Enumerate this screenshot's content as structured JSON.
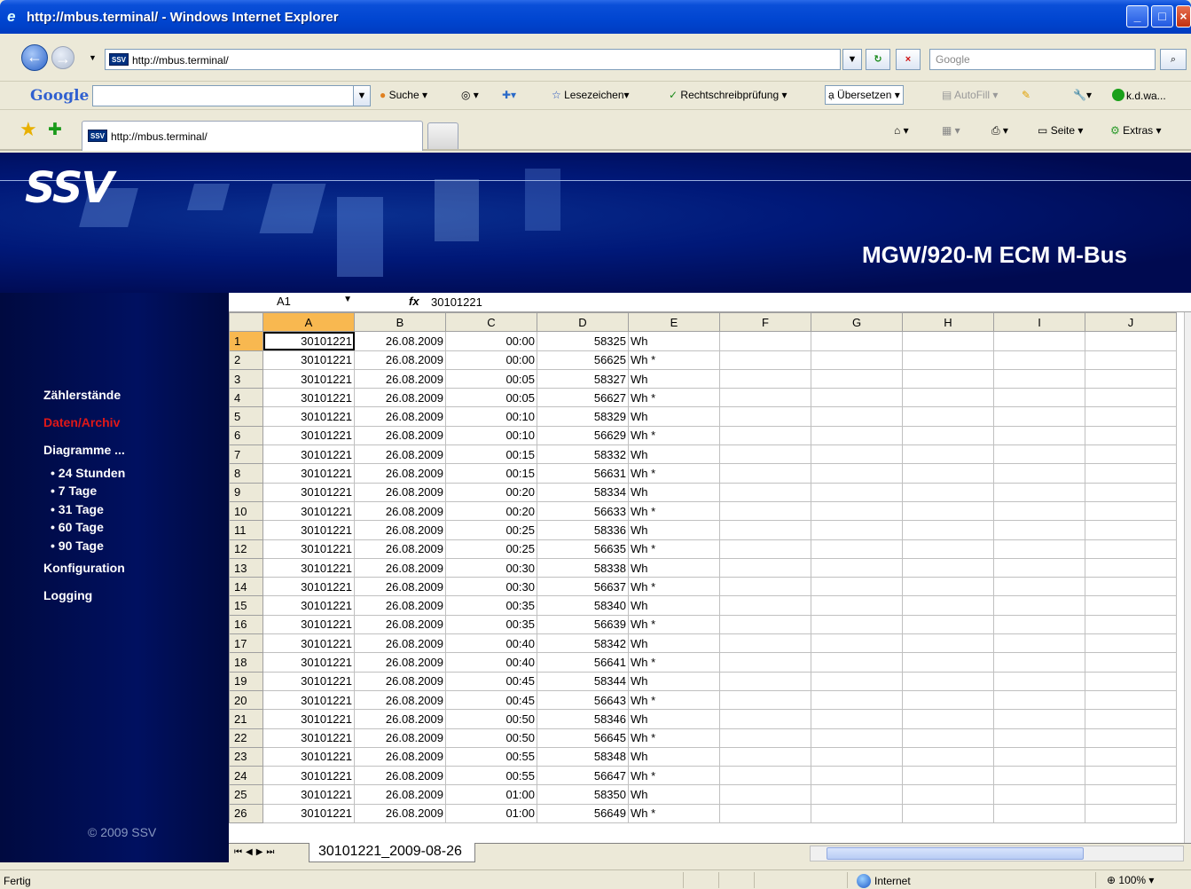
{
  "window": {
    "title": "http://mbus.terminal/ - Windows Internet Explorer"
  },
  "address": {
    "url": "http://mbus.terminal/",
    "search_placeholder": "Google"
  },
  "google_toolbar": {
    "logo": "Google",
    "search_label": "Suche",
    "bookmarks": "Lesezeichen",
    "spellcheck": "Rechtschreibprüfung",
    "translate": "Übersetzen",
    "autofill": "AutoFill",
    "user": "k.d.wa..."
  },
  "tab": {
    "label": "http://mbus.terminal/"
  },
  "commandbar": {
    "page": "Seite",
    "extras": "Extras"
  },
  "banner": {
    "logo": "SSV",
    "product": "MGW/920-M ECM M-Bus"
  },
  "sidebar": {
    "items": [
      {
        "label": "Zählerstände",
        "active": false
      },
      {
        "label": "Daten/Archiv",
        "active": true
      },
      {
        "label": "Diagramme ...",
        "active": false
      },
      {
        "label": "• 24 Stunden",
        "sub": true
      },
      {
        "label": "• 7 Tage",
        "sub": true
      },
      {
        "label": "• 31 Tage",
        "sub": true
      },
      {
        "label": "• 60 Tage",
        "sub": true
      },
      {
        "label": "• 90 Tage",
        "sub": true
      },
      {
        "label": "Konfiguration",
        "active": false
      },
      {
        "label": "Logging",
        "active": false
      }
    ],
    "copyright": "© 2009 SSV"
  },
  "spreadsheet": {
    "name_box": "A1",
    "fx_symbol": "fx",
    "formula_value": "30101221",
    "columns": [
      "A",
      "B",
      "C",
      "D",
      "E",
      "F",
      "G",
      "H",
      "I",
      "J"
    ],
    "rows": [
      [
        "30101221",
        "26.08.2009",
        "00:00",
        "58325",
        "Wh"
      ],
      [
        "30101221",
        "26.08.2009",
        "00:00",
        "56625",
        "Wh *"
      ],
      [
        "30101221",
        "26.08.2009",
        "00:05",
        "58327",
        "Wh"
      ],
      [
        "30101221",
        "26.08.2009",
        "00:05",
        "56627",
        "Wh *"
      ],
      [
        "30101221",
        "26.08.2009",
        "00:10",
        "58329",
        "Wh"
      ],
      [
        "30101221",
        "26.08.2009",
        "00:10",
        "56629",
        "Wh *"
      ],
      [
        "30101221",
        "26.08.2009",
        "00:15",
        "58332",
        "Wh"
      ],
      [
        "30101221",
        "26.08.2009",
        "00:15",
        "56631",
        "Wh *"
      ],
      [
        "30101221",
        "26.08.2009",
        "00:20",
        "58334",
        "Wh"
      ],
      [
        "30101221",
        "26.08.2009",
        "00:20",
        "56633",
        "Wh *"
      ],
      [
        "30101221",
        "26.08.2009",
        "00:25",
        "58336",
        "Wh"
      ],
      [
        "30101221",
        "26.08.2009",
        "00:25",
        "56635",
        "Wh *"
      ],
      [
        "30101221",
        "26.08.2009",
        "00:30",
        "58338",
        "Wh"
      ],
      [
        "30101221",
        "26.08.2009",
        "00:30",
        "56637",
        "Wh *"
      ],
      [
        "30101221",
        "26.08.2009",
        "00:35",
        "58340",
        "Wh"
      ],
      [
        "30101221",
        "26.08.2009",
        "00:35",
        "56639",
        "Wh *"
      ],
      [
        "30101221",
        "26.08.2009",
        "00:40",
        "58342",
        "Wh"
      ],
      [
        "30101221",
        "26.08.2009",
        "00:40",
        "56641",
        "Wh *"
      ],
      [
        "30101221",
        "26.08.2009",
        "00:45",
        "58344",
        "Wh"
      ],
      [
        "30101221",
        "26.08.2009",
        "00:45",
        "56643",
        "Wh *"
      ],
      [
        "30101221",
        "26.08.2009",
        "00:50",
        "58346",
        "Wh"
      ],
      [
        "30101221",
        "26.08.2009",
        "00:50",
        "56645",
        "Wh *"
      ],
      [
        "30101221",
        "26.08.2009",
        "00:55",
        "58348",
        "Wh"
      ],
      [
        "30101221",
        "26.08.2009",
        "00:55",
        "56647",
        "Wh *"
      ],
      [
        "30101221",
        "26.08.2009",
        "01:00",
        "58350",
        "Wh"
      ],
      [
        "30101221",
        "26.08.2009",
        "01:00",
        "56649",
        "Wh *"
      ]
    ],
    "sheet_tab": "30101221_2009-08-26"
  },
  "statusbar": {
    "text": "Fertig",
    "zone": "Internet",
    "zoom": "100%"
  },
  "colors": {
    "titlebar": "#0045d0",
    "page_bg": "#000a40",
    "active_nav": "#e01818",
    "selected_header": "#f8b850"
  }
}
